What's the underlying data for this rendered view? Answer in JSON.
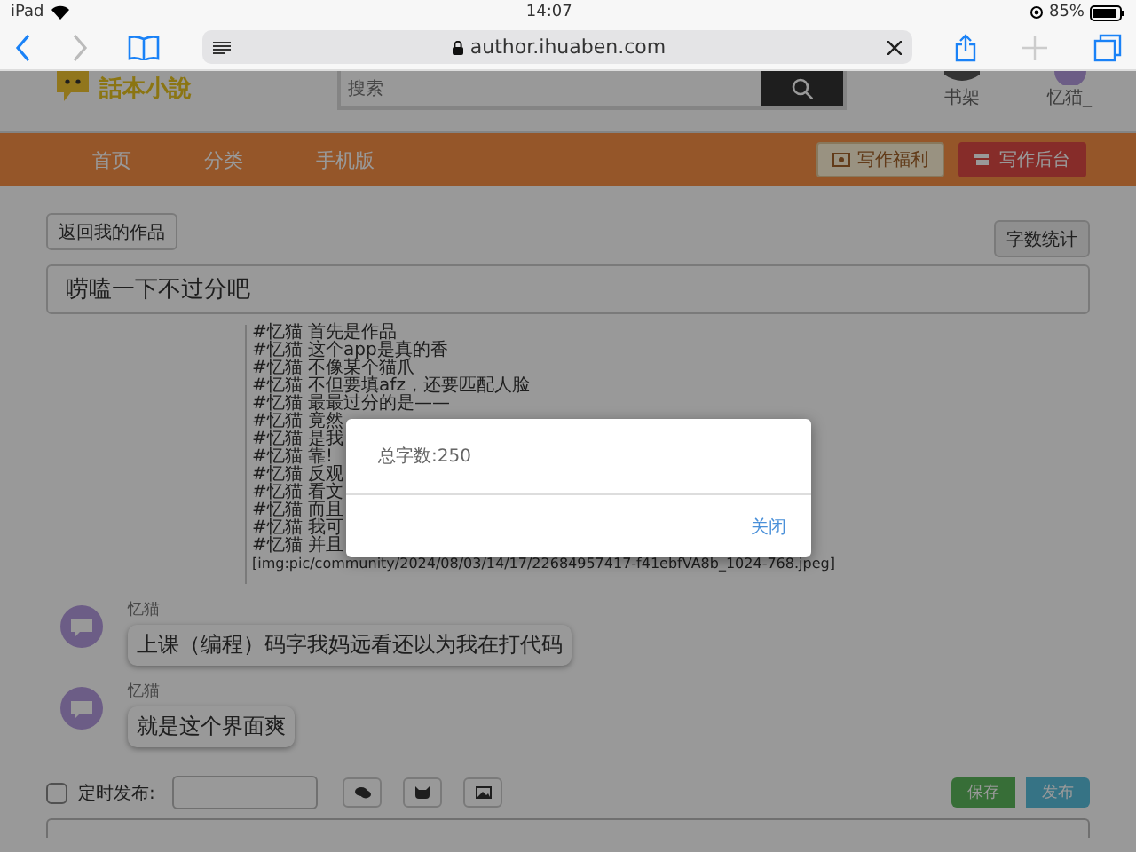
{
  "status_bar": {
    "device": "iPad",
    "time": "14:07",
    "battery": "85%"
  },
  "browser": {
    "url": "author.ihuaben.com"
  },
  "header": {
    "logo": "話本小說",
    "search": {
      "placeholder": "搜索"
    },
    "shelf": "书架",
    "user": "忆猫_"
  },
  "nav": {
    "items": [
      {
        "label": "首页"
      },
      {
        "label": "分类"
      },
      {
        "label": "手机版"
      }
    ],
    "buttons": [
      {
        "label": "写作福利",
        "kind": "welfare"
      },
      {
        "label": "写作后台",
        "kind": "backend"
      }
    ]
  },
  "toolbar": {
    "back": "返回我的作品",
    "count": "字数统计"
  },
  "title_field": {
    "value": "唠嗑一下不过分吧"
  },
  "editor": {
    "lines": [
      "#忆猫 首先是作品",
      "#忆猫 这个app是真的香",
      "#忆猫 不像某个猫爪",
      "#忆猫 不但要填afz，还要匹配人脸",
      "#忆猫 最最过分的是——",
      "#忆猫 竟然",
      "#忆猫 是我",
      "#忆猫 靠!",
      "#忆猫 反观",
      "#忆猫 看文",
      "#忆猫 而且",
      "#忆猫 我可",
      "#忆猫 并且"
    ],
    "image_tag": "[img:pic/community/2024/08/03/14/17/22684957417-f41ebfVA8b_1024-768.jpeg]"
  },
  "comments": [
    {
      "name": "忆猫",
      "text": "上课（编程）码字我妈远看还以为我在打代码"
    },
    {
      "name": "忆猫",
      "text": "就是这个界面爽"
    }
  ],
  "footer": {
    "schedule": {
      "label": "定时发布:",
      "checked": false
    },
    "save": "保存",
    "publish": "发布"
  },
  "dialog": {
    "message": "总字数:250",
    "close": "关闭"
  }
}
